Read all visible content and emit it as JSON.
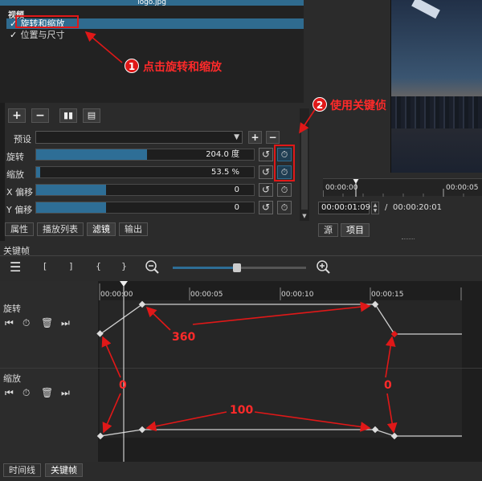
{
  "filter_panel": {
    "top_file": "logo.jpg",
    "section_label": "视频",
    "filters": [
      {
        "label": "旋转和缩放",
        "checked": true,
        "selected": true
      },
      {
        "label": "位置与尺寸",
        "checked": true,
        "selected": false
      }
    ],
    "check_glyph": "✓"
  },
  "toolbar_icons": [
    "plus-icon",
    "minus-icon",
    "copy-icon",
    "paste-icon"
  ],
  "preset": {
    "label": "预设",
    "value": ""
  },
  "params": [
    {
      "label": "旋转",
      "value": "204.0 度",
      "fill_fraction": 0.51
    },
    {
      "label": "缩放",
      "value": "53.5 %",
      "fill_fraction": 0.02
    },
    {
      "label": "X 偏移",
      "value": "0",
      "fill_fraction": 0.32
    },
    {
      "label": "Y 偏移",
      "value": "0",
      "fill_fraction": 0.32
    }
  ],
  "left_tabs": [
    {
      "label": "属性",
      "active": false
    },
    {
      "label": "播放列表",
      "active": false
    },
    {
      "label": "滤镜",
      "active": true
    },
    {
      "label": "输出",
      "active": false
    }
  ],
  "player": {
    "ruler_start": "00:00:00",
    "ruler_mark": "00:00:05",
    "current_time": "00:00:01:09",
    "separator": "/",
    "total_time": "00:00:20:01"
  },
  "right_tabs": [
    {
      "label": "源",
      "active": false
    },
    {
      "label": "项目",
      "active": true
    }
  ],
  "keyframes": {
    "title": "关键帧",
    "toolbar_glyphs": [
      "[",
      "]",
      "{",
      "}"
    ],
    "zoom_level": 0.48,
    "ruler": [
      "00:00:00",
      "00:00:05",
      "00:00:10",
      "00:00:15"
    ],
    "tracks": [
      {
        "label": "旋转",
        "keyframe_values": [
          0,
          360,
          360,
          0
        ]
      },
      {
        "label": "缩放",
        "keyframe_values": [
          0,
          100,
          100,
          0
        ]
      }
    ]
  },
  "bottom_tabs": [
    {
      "label": "时间线",
      "active": false
    },
    {
      "label": "关键帧",
      "active": true
    }
  ],
  "annotations": {
    "step1_number": "1",
    "step1_text": "点击旋转和缩放",
    "step2_number": "2",
    "step2_text": "使用关键侦",
    "label_360": "360",
    "label_0_left": "0",
    "label_100": "100",
    "label_0_right": "0",
    "color": "#e01818"
  },
  "colors": {
    "accent": "#2f6b8f",
    "slider_fill": "#2e6e96",
    "panel": "#2b2b2b"
  }
}
